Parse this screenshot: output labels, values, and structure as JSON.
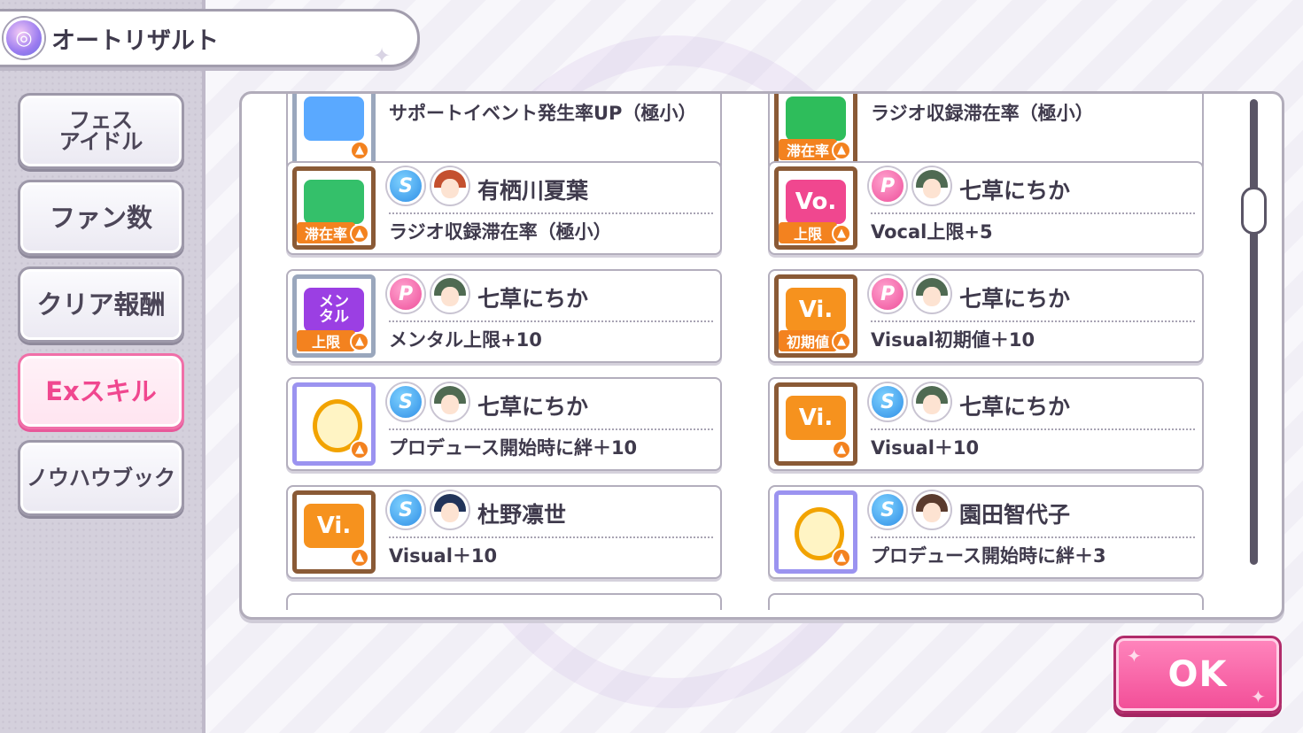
{
  "header": {
    "title": "オートリザルト",
    "icon": "result-swirl-icon"
  },
  "sidebar": {
    "items": [
      {
        "label": "フェス\nアイドル",
        "active": false
      },
      {
        "label": "ファン数",
        "active": false
      },
      {
        "label": "クリア報酬",
        "active": false
      },
      {
        "label": "Exスキル",
        "active": true
      },
      {
        "label": "ノウハウブック",
        "active": false
      }
    ]
  },
  "skills": {
    "left": [
      {
        "idol": "",
        "effect": "サポートイベント発生率UP（極小）",
        "icon": "support-event-icon"
      },
      {
        "type": "S",
        "idol": "有栖川夏葉",
        "effect": "ラジオ収録滞在率（極小）",
        "icon": "radio-icon",
        "icon_tag": "滞在率"
      },
      {
        "type": "P",
        "idol": "七草にちか",
        "effect": "メンタル上限+10",
        "icon": "mental-icon",
        "icon_text": "メン\nタル",
        "icon_tag": "上限"
      },
      {
        "type": "S",
        "idol": "七草にちか",
        "effect": "プロデュース開始時に絆＋10",
        "icon": "bond-icon"
      },
      {
        "type": "S",
        "idol": "杜野凛世",
        "effect": "Visual＋10",
        "icon": "visual-icon",
        "icon_text": "Vi."
      }
    ],
    "right": [
      {
        "idol": "",
        "effect": "ラジオ収録滞在率（極小）",
        "icon": "stay-rate-icon",
        "icon_tag": "滞在率"
      },
      {
        "type": "P",
        "idol": "七草にちか",
        "effect": "Vocal上限+5",
        "icon": "vocal-icon",
        "icon_text": "Vo.",
        "icon_tag": "上限"
      },
      {
        "type": "P",
        "idol": "七草にちか",
        "effect": "Visual初期値＋10",
        "icon": "visual-icon",
        "icon_text": "Vi.",
        "icon_tag": "初期値"
      },
      {
        "type": "S",
        "idol": "七草にちか",
        "effect": "Visual＋10",
        "icon": "visual-icon",
        "icon_text": "Vi."
      },
      {
        "type": "S",
        "idol": "園田智代子",
        "effect": "プロデュース開始時に絆＋3",
        "icon": "bond-icon"
      }
    ]
  },
  "type_labels": {
    "S": "S",
    "P": "P"
  },
  "ok_button": {
    "label": "OK"
  },
  "colors": {
    "accent_pink": "#f24d97",
    "support_blue": "#2f8ee6",
    "produce_pink": "#ee4f9a",
    "frame_brown": "#8a5a36"
  }
}
